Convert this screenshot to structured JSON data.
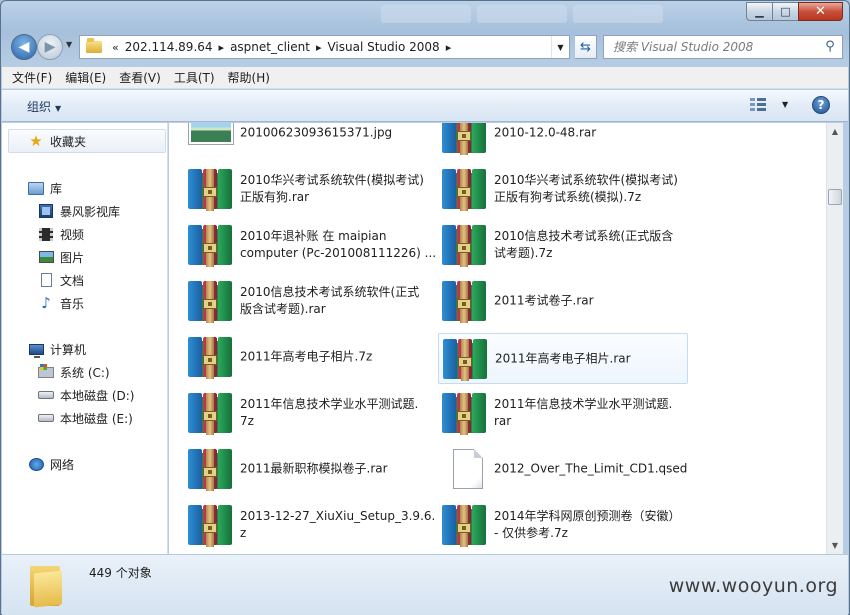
{
  "address": {
    "history_marker": "«",
    "crumbs": [
      "202.114.89.64",
      "aspnet_client",
      "Visual Studio 2008"
    ],
    "separator": "▸"
  },
  "search": {
    "placeholder": "搜索 Visual Studio 2008"
  },
  "menu": [
    "文件(F)",
    "编辑(E)",
    "查看(V)",
    "工具(T)",
    "帮助(H)"
  ],
  "toolbar": {
    "organize": "组织"
  },
  "sidebar": {
    "favorites": "收藏夹",
    "libraries": {
      "label": "库",
      "items": [
        "暴风影视库",
        "视频",
        "图片",
        "文档",
        "音乐"
      ]
    },
    "computer": {
      "label": "计算机",
      "items": [
        "系统 (C:)",
        "本地磁盘 (D:)",
        "本地磁盘 (E:)"
      ]
    },
    "network": "网络"
  },
  "files": [
    {
      "name": [
        "20100623093615371.jpg"
      ],
      "icon": "image-thumbnail"
    },
    {
      "name": [
        "2010-12.0-48.rar"
      ],
      "icon": "winrar-archive"
    },
    {
      "name": [
        "2010华兴考试系统软件(模拟考试)",
        "正版有狗.rar"
      ],
      "icon": "winrar-archive"
    },
    {
      "name": [
        "2010华兴考试系统软件(模拟考试)",
        "正版有狗考试系统(模拟).7z"
      ],
      "icon": "winrar-archive"
    },
    {
      "name": [
        "2010年退补账 在 maipian",
        "computer (Pc-201008111226) ..."
      ],
      "icon": "winrar-archive"
    },
    {
      "name": [
        "2010信息技术考试系统(正式版含",
        "试考题).7z"
      ],
      "icon": "winrar-archive"
    },
    {
      "name": [
        "2010信息技术考试系统软件(正式",
        "版含试考题).rar"
      ],
      "icon": "winrar-archive"
    },
    {
      "name": [
        "2011考试卷子.rar"
      ],
      "icon": "winrar-archive"
    },
    {
      "name": [
        "2011年高考电子相片.7z"
      ],
      "icon": "winrar-archive"
    },
    {
      "name": [
        "2011年高考电子相片.rar"
      ],
      "icon": "winrar-archive",
      "selected": true
    },
    {
      "name": [
        "2011年信息技术学业水平测试题.",
        "7z"
      ],
      "icon": "winrar-archive"
    },
    {
      "name": [
        "2011年信息技术学业水平测试题.",
        "rar"
      ],
      "icon": "winrar-archive"
    },
    {
      "name": [
        "2011最新职称模拟卷子.rar"
      ],
      "icon": "winrar-archive"
    },
    {
      "name": [
        "2012_Over_The_Limit_CD1.qsed"
      ],
      "icon": "blank-file"
    },
    {
      "name": [
        "2013-12-27_XiuXiu_Setup_3.9.6.7",
        "z"
      ],
      "icon": "winrar-archive"
    },
    {
      "name": [
        "2014年学科网原创预测卷（安徽）",
        "- 仅供参考.7z"
      ],
      "icon": "winrar-archive"
    }
  ],
  "status": {
    "count": "449 个对象"
  },
  "watermark": "www.wooyun.org"
}
